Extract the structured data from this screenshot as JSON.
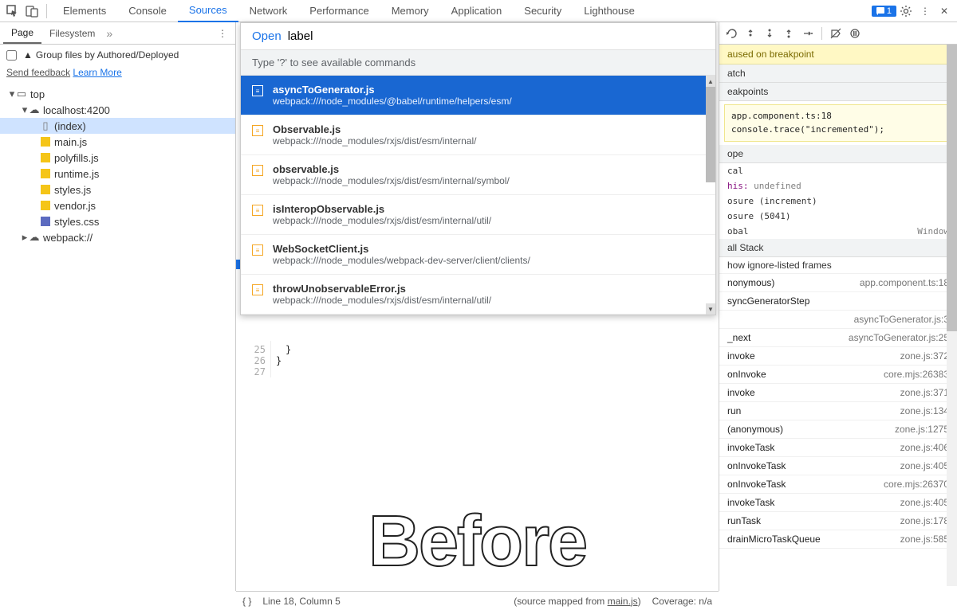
{
  "topTabs": [
    "Elements",
    "Console",
    "Sources",
    "Network",
    "Performance",
    "Memory",
    "Application",
    "Security",
    "Lighthouse"
  ],
  "topActive": 2,
  "issuesBadge": "1",
  "leftTabs": {
    "page": "Page",
    "filesystem": "Filesystem"
  },
  "groupLabel": "Group files by Authored/Deployed",
  "sendFeedback": "Send feedback",
  "learnMore": "Learn More",
  "tree": {
    "top": "top",
    "host": "localhost:4200",
    "files": [
      "(index)",
      "main.js",
      "polyfills.js",
      "runtime.js",
      "styles.js",
      "vendor.js",
      "styles.css"
    ],
    "webpack": "webpack://"
  },
  "dropdown": {
    "openLabel": "Open",
    "query": "label",
    "hint": "Type '?' to see available commands",
    "items": [
      {
        "title": "asyncToGenerator.js",
        "sub": "webpack:///node_modules/@babel/runtime/helpers/esm/"
      },
      {
        "title": "Observable.js",
        "sub": "webpack:///node_modules/rxjs/dist/esm/internal/"
      },
      {
        "title": "observable.js",
        "sub": "webpack:///node_modules/rxjs/dist/esm/internal/symbol/"
      },
      {
        "title": "isInteropObservable.js",
        "sub": "webpack:///node_modules/rxjs/dist/esm/internal/util/"
      },
      {
        "title": "WebSocketClient.js",
        "sub": "webpack:///node_modules/webpack-dev-server/client/clients/"
      },
      {
        "title": "throwUnobservableError.js",
        "sub": "webpack:///node_modules/rxjs/dist/esm/internal/util/"
      }
    ]
  },
  "paused": "aused on breakpoint",
  "watch": "atch",
  "breakpoints": "eakpoints",
  "bpCode": {
    "line1": "app.component.ts:18",
    "line2": "console.trace(\"incremented\");"
  },
  "scope": "ope",
  "scopeLocal": "cal",
  "scopeThisKey": "his:",
  "scopeThisVal": "undefined",
  "scopeC1": "osure (increment)",
  "scopeC2": "osure (5041)",
  "scopeGlobal": "obal",
  "scopeGlobalVal": "Window",
  "callStackH": "all Stack",
  "ignoreListed": "how ignore-listed frames",
  "stack": [
    {
      "fn": "nonymous)",
      "loc": "app.component.ts:18"
    },
    {
      "fn": "syncGeneratorStep",
      "loc": ""
    },
    {
      "fn": "",
      "loc": "asyncToGenerator.js:3"
    },
    {
      "fn": "_next",
      "loc": "asyncToGenerator.js:25"
    },
    {
      "fn": "invoke",
      "loc": "zone.js:372"
    },
    {
      "fn": "onInvoke",
      "loc": "core.mjs:26383"
    },
    {
      "fn": "invoke",
      "loc": "zone.js:371"
    },
    {
      "fn": "run",
      "loc": "zone.js:134"
    },
    {
      "fn": "(anonymous)",
      "loc": "zone.js:1275"
    },
    {
      "fn": "invokeTask",
      "loc": "zone.js:406"
    },
    {
      "fn": "onInvokeTask",
      "loc": "zone.js:405"
    },
    {
      "fn": "onInvokeTask",
      "loc": "core.mjs:26370"
    },
    {
      "fn": "invokeTask",
      "loc": "zone.js:405"
    },
    {
      "fn": "runTask",
      "loc": "zone.js:178"
    },
    {
      "fn": "drainMicroTaskQueue",
      "loc": "zone.js:585"
    }
  ],
  "gutter": [
    "25",
    "26",
    "27"
  ],
  "braces": [
    "}",
    "}"
  ],
  "status": {
    "lineCol": "Line 18, Column 5",
    "mapped": "(source mapped from ",
    "mapFile": "main.js",
    "mapEnd": ")",
    "cov": "Coverage: n/a"
  },
  "before": "Before"
}
